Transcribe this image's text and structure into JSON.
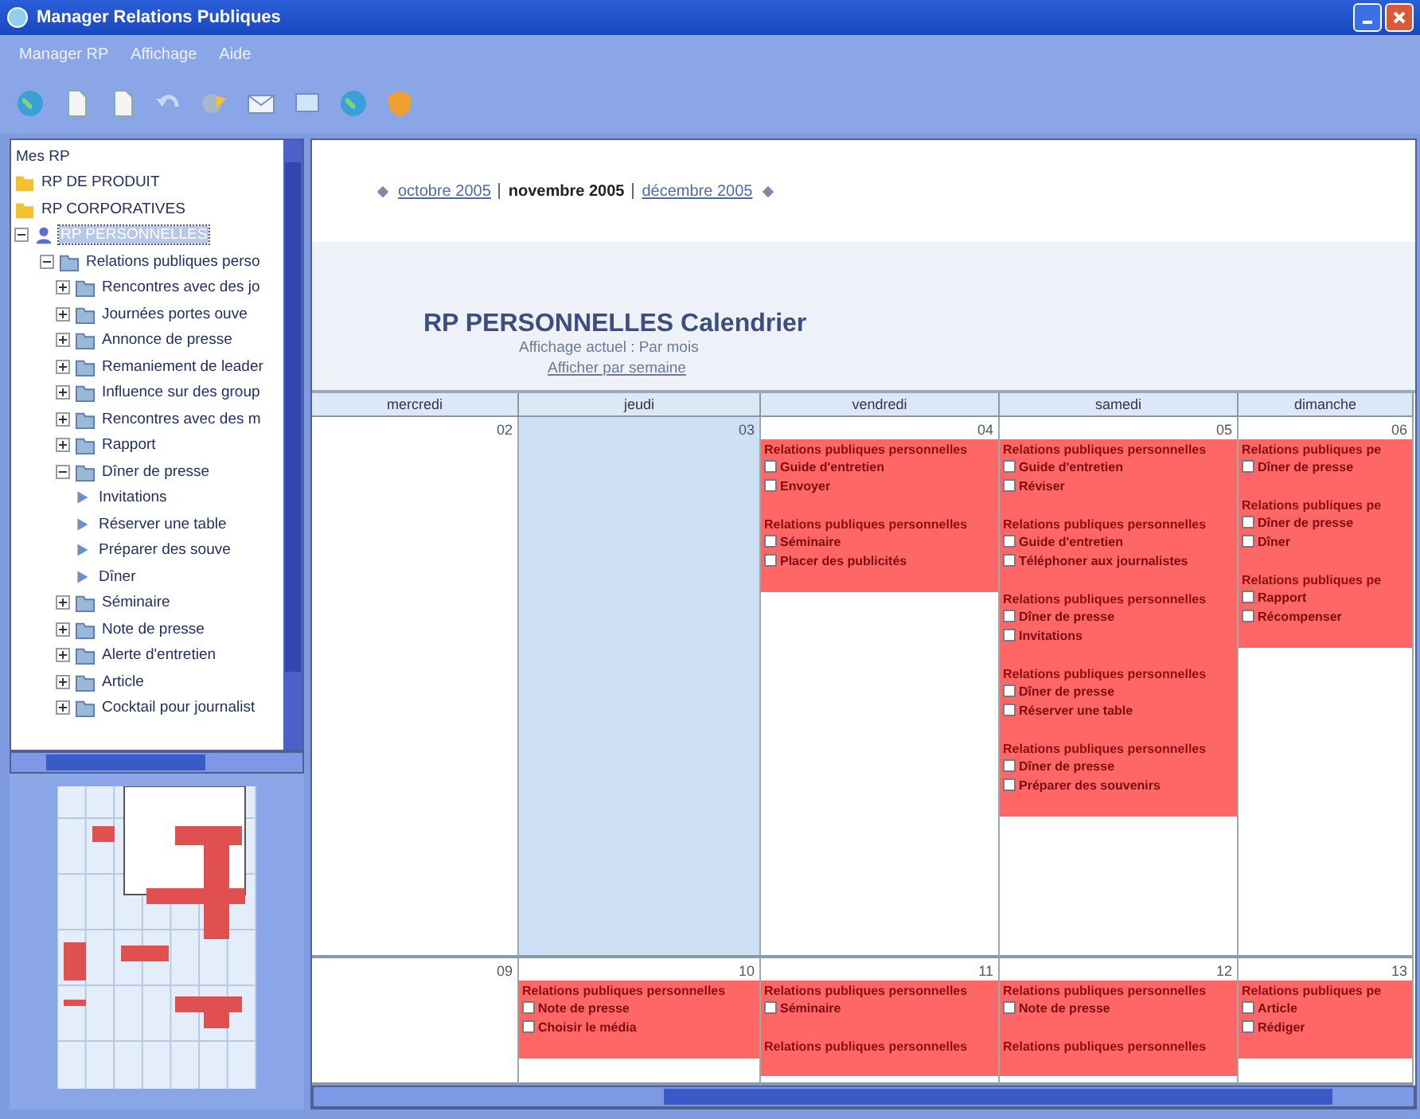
{
  "window": {
    "title": "Manager Relations Publiques"
  },
  "menu": [
    "Manager RP",
    "Affichage",
    "Aide"
  ],
  "toolbar": [
    {
      "kind": "globe"
    },
    {
      "kind": "page"
    },
    {
      "kind": "page"
    },
    {
      "kind": "undo"
    },
    {
      "kind": "tools"
    },
    {
      "kind": "mail"
    },
    {
      "kind": "screen"
    },
    {
      "kind": "globe"
    },
    {
      "kind": "shield"
    }
  ],
  "tree": {
    "root": "Mes RP",
    "items": [
      {
        "label": "RP DE PRODUIT",
        "kind": "category",
        "selected": false
      },
      {
        "label": "RP CORPORATIVES",
        "kind": "category",
        "selected": false
      },
      {
        "label": "RP PERSONNELLES",
        "kind": "personal",
        "selected": true,
        "expanded": true,
        "children": [
          {
            "label": "Relations publiques perso",
            "kind": "group",
            "selected": false,
            "expanded": true,
            "children": [
              {
                "label": "Rencontres avec des jo",
                "kind": "group",
                "selected": false,
                "expanded": false
              },
              {
                "label": "Journées portes ouve",
                "kind": "group",
                "selected": false,
                "expanded": false
              },
              {
                "label": "Annonce de presse",
                "kind": "group",
                "selected": false,
                "expanded": false
              },
              {
                "label": "Remaniement de leader",
                "kind": "group",
                "selected": false,
                "expanded": false
              },
              {
                "label": "Influence sur des group",
                "kind": "group",
                "selected": false,
                "expanded": false
              },
              {
                "label": "Rencontres avec des m",
                "kind": "group",
                "selected": false,
                "expanded": false
              },
              {
                "label": "Rapport",
                "kind": "group",
                "selected": false,
                "expanded": false
              },
              {
                "label": "Dîner de presse",
                "kind": "group",
                "selected": false,
                "expanded": true,
                "children": [
                  {
                    "label": "Invitations",
                    "kind": "task",
                    "selected": false
                  },
                  {
                    "label": "Réserver une table",
                    "kind": "task",
                    "selected": false
                  },
                  {
                    "label": "Préparer des souve",
                    "kind": "task",
                    "selected": false
                  },
                  {
                    "label": "Dîner",
                    "kind": "task",
                    "selected": false
                  }
                ]
              },
              {
                "label": "Séminaire",
                "kind": "group",
                "selected": false,
                "expanded": false
              },
              {
                "label": "Note de presse",
                "kind": "group",
                "selected": false,
                "expanded": false
              },
              {
                "label": "Alerte d'entretien",
                "kind": "group",
                "selected": false,
                "expanded": false
              },
              {
                "label": "Article",
                "kind": "group",
                "selected": false,
                "expanded": false
              },
              {
                "label": "Cocktail pour journalist",
                "kind": "group",
                "selected": false,
                "expanded": false
              }
            ]
          }
        ]
      }
    ]
  },
  "calendar": {
    "nav": {
      "previous": "octobre 2005",
      "current": "novembre 2005",
      "next": "décembre 2005"
    },
    "title": "RP PERSONNELLES Calendrier",
    "view": "Affichage actuel : Par mois",
    "switch_link": "Afficher par semaine",
    "weekdays": [
      "mercredi",
      "jeudi",
      "vendredi",
      "samedi",
      "dimanche"
    ],
    "weeks": [
      {
        "days": [
          {
            "number": "02",
            "today": false
          },
          {
            "number": "03",
            "today": true
          },
          {
            "number": "04",
            "today": false,
            "events": [
              {
                "title": "Relations publiques personnelles",
                "tasks": [
                  "Guide d'entretien",
                  "Envoyer"
                ]
              },
              {
                "title": "Relations publiques personnelles",
                "tasks": [
                  "Séminaire",
                  "Placer des publicités"
                ]
              }
            ]
          },
          {
            "number": "05",
            "today": false,
            "events": [
              {
                "title": "Relations publiques personnelles",
                "tasks": [
                  "Guide d'entretien",
                  "Réviser"
                ]
              },
              {
                "title": "Relations publiques personnelles",
                "tasks": [
                  "Guide d'entretien",
                  "Téléphoner aux journalistes"
                ]
              },
              {
                "title": "Relations publiques personnelles",
                "tasks": [
                  "Dîner de presse",
                  "Invitations"
                ]
              },
              {
                "title": "Relations publiques personnelles",
                "tasks": [
                  "Dîner de presse",
                  "Réserver une table"
                ]
              },
              {
                "title": "Relations publiques personnelles",
                "tasks": [
                  "Dîner de presse",
                  "Préparer des souvenirs"
                ]
              }
            ]
          },
          {
            "number": "06",
            "today": false,
            "events": [
              {
                "title": "Relations publiques pe",
                "tasks": [
                  "Dîner de presse"
                ]
              },
              {
                "title": "Relations publiques pe",
                "tasks": [
                  "Dîner de presse",
                  "Dîner"
                ]
              },
              {
                "title": "Relations publiques pe",
                "tasks": [
                  "Rapport",
                  "Récompenser"
                ]
              }
            ]
          }
        ]
      },
      {
        "days": [
          {
            "number": "09",
            "today": false
          },
          {
            "number": "10",
            "today": false,
            "events": [
              {
                "title": "Relations publiques personnelles",
                "tasks": [
                  "Note de presse",
                  "Choisir le média"
                ]
              }
            ]
          },
          {
            "number": "11",
            "today": false,
            "events": [
              {
                "title": "Relations publiques personnelles",
                "tasks": [
                  "Séminaire"
                ]
              },
              {
                "title": "Relations publiques personnelles"
              }
            ]
          },
          {
            "number": "12",
            "today": false,
            "events": [
              {
                "title": "Relations publiques personnelles",
                "tasks": [
                  "Note de presse"
                ]
              },
              {
                "title": "Relations publiques personnelles"
              }
            ]
          },
          {
            "number": "13",
            "today": false,
            "events": [
              {
                "title": "Relations publiques pe",
                "tasks": [
                  "Article",
                  "Rédiger"
                ]
              }
            ]
          }
        ]
      }
    ]
  }
}
